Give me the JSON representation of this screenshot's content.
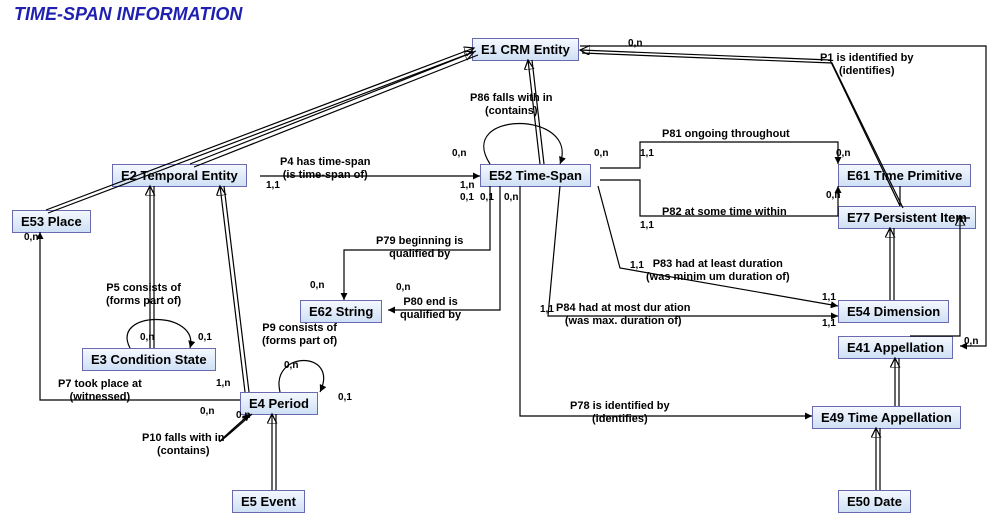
{
  "title": "TIME-SPAN INFORMATION",
  "entities": {
    "e1": "E1 CRM Entity",
    "e2": "E2 Temporal Entity",
    "e3": "E3 Condition State",
    "e4": "E4 Period",
    "e5": "E5 Event",
    "e52": "E52 Time-Span",
    "e53": "E53 Place",
    "e62": "E62 String",
    "e61": "E61 Time Primitive",
    "e77": "E77 Persistent Item",
    "e54": "E54 Dimension",
    "e41": "E41 Appellation",
    "e49": "E49 Time Appellation",
    "e50": "E50 Date"
  },
  "relations": {
    "p4a": "P4 has time-span",
    "p4b": "(is time-span of)",
    "p5a": "P5 consists of",
    "p5b": "(forms part of)",
    "p7a": "P7 took place at",
    "p7b": "(witnessed)",
    "p9a": "P9 consists of",
    "p9b": "(forms part of)",
    "p10a": "P10 falls with in",
    "p10b": "(contains)",
    "p79a": "P79 beginning is",
    "p79b": "qualified by",
    "p80a": "P80 end is",
    "p80b": "qualified by",
    "p86a": "P86 falls with in",
    "p86b": "(contains)",
    "p81": "P81 ongoing  throughout",
    "p82": "P82 at some  time within",
    "p83a": "P83 had at  least duration",
    "p83b": "(was minim um duration of)",
    "p84a": "P84 had at  most dur   ation",
    "p84b": "(was max.  duration  of)",
    "p78a": "P78 is identified  by",
    "p78b": "(identifies)",
    "p1a": "P1 is identified by",
    "p1b": "(identifies)"
  },
  "card": {
    "z1": "0,n",
    "z2": "0,n",
    "z3": "0,n",
    "z4": "0,n",
    "z5": "0,n",
    "z6": "0,n",
    "z7": "0,n",
    "z8": "0,n",
    "z9": "0,n",
    "z10": "0,n",
    "z11": "0,n",
    "z12": "0,n",
    "o1": "1,1",
    "o2": "1,1",
    "o3": "1,1",
    "o4": "1,1",
    "o5": "1,1",
    "o6": "1,1",
    "o7": "1,1",
    "o8": "1,n",
    "o9": "0,1",
    "o10": "0,1",
    "o11": "0,1",
    "o12": "1,n"
  },
  "chart_data": {
    "type": "diagram",
    "title": "TIME-SPAN INFORMATION",
    "entities": [
      {
        "id": "E1",
        "label": "E1 CRM Entity"
      },
      {
        "id": "E2",
        "label": "E2 Temporal Entity"
      },
      {
        "id": "E3",
        "label": "E3 Condition State"
      },
      {
        "id": "E4",
        "label": "E4 Period"
      },
      {
        "id": "E5",
        "label": "E5 Event"
      },
      {
        "id": "E52",
        "label": "E52 Time-Span"
      },
      {
        "id": "E53",
        "label": "E53 Place"
      },
      {
        "id": "E62",
        "label": "E62 String"
      },
      {
        "id": "E61",
        "label": "E61 Time Primitive"
      },
      {
        "id": "E77",
        "label": "E77 Persistent Item"
      },
      {
        "id": "E54",
        "label": "E54 Dimension"
      },
      {
        "id": "E41",
        "label": "E41 Appellation"
      },
      {
        "id": "E49",
        "label": "E49 Time Appellation"
      },
      {
        "id": "E50",
        "label": "E50 Date"
      }
    ],
    "relations": [
      {
        "id": "P1",
        "label": "P1 is identified by (identifies)",
        "from": "E1",
        "to": "E41",
        "card_from": "0,n",
        "card_to": "0,n"
      },
      {
        "id": "P4",
        "label": "P4 has time-span (is time-span of)",
        "from": "E2",
        "to": "E52",
        "card_from": "1,1",
        "card_to": "1,n"
      },
      {
        "id": "P5",
        "label": "P5 consists of (forms part of)",
        "from": "E3",
        "to": "E3",
        "card_from": "0,n",
        "card_to": "0,1"
      },
      {
        "id": "P7",
        "label": "P7 took place at (witnessed)",
        "from": "E4",
        "to": "E53",
        "card_from": "1,n",
        "card_to": "0,n"
      },
      {
        "id": "P9",
        "label": "P9 consists of (forms part of)",
        "from": "E4",
        "to": "E4",
        "card_from": "0,n",
        "card_to": "0,1"
      },
      {
        "id": "P10",
        "label": "P10 falls with in (contains)",
        "from": "E4",
        "to": "E4",
        "card_from": "0,n",
        "card_to": "0,n"
      },
      {
        "id": "P78",
        "label": "P78 is identified by (identifies)",
        "from": "E52",
        "to": "E49",
        "card_from": "0,n",
        "card_to": "1,1"
      },
      {
        "id": "P79",
        "label": "P79 beginning is qualified by",
        "from": "E52",
        "to": "E62",
        "card_from": "0,1",
        "card_to": "0,n"
      },
      {
        "id": "P80",
        "label": "P80 end is qualified by",
        "from": "E52",
        "to": "E62",
        "card_from": "0,1",
        "card_to": "0,n"
      },
      {
        "id": "P81",
        "label": "P81 ongoing throughout",
        "from": "E52",
        "to": "E61",
        "card_from": "1,1",
        "card_to": "0,n"
      },
      {
        "id": "P82",
        "label": "P82 at some time within",
        "from": "E52",
        "to": "E61",
        "card_from": "1,1",
        "card_to": "0,n"
      },
      {
        "id": "P83",
        "label": "P83 had at least duration (was minimum duration of)",
        "from": "E52",
        "to": "E54",
        "card_from": "1,1",
        "card_to": "1,1"
      },
      {
        "id": "P84",
        "label": "P84 had at most duration (was max. duration of)",
        "from": "E52",
        "to": "E54",
        "card_from": "1,1",
        "card_to": "1,1"
      },
      {
        "id": "P86",
        "label": "P86 falls with in (contains)",
        "from": "E52",
        "to": "E52",
        "card_from": "0,n",
        "card_to": "0,n"
      }
    ],
    "isa": [
      {
        "child": "E2",
        "parent": "E1"
      },
      {
        "child": "E52",
        "parent": "E1"
      },
      {
        "child": "E53",
        "parent": "E1"
      },
      {
        "child": "E77",
        "parent": "E1"
      },
      {
        "child": "E3",
        "parent": "E2"
      },
      {
        "child": "E4",
        "parent": "E2"
      },
      {
        "child": "E5",
        "parent": "E4"
      },
      {
        "child": "E61",
        "parent": "E77"
      },
      {
        "child": "E41",
        "parent": "E77"
      },
      {
        "child": "E54",
        "parent": "E77"
      },
      {
        "child": "E49",
        "parent": "E41"
      },
      {
        "child": "E50",
        "parent": "E49"
      }
    ]
  }
}
